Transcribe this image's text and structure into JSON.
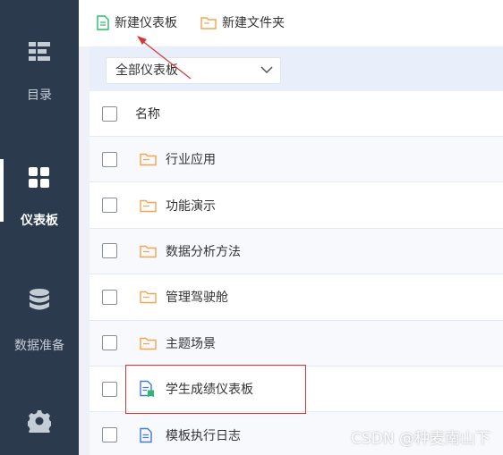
{
  "sidebar": {
    "items": [
      {
        "label": "目录",
        "icon": "catalog-icon",
        "active": false
      },
      {
        "label": "仪表板",
        "icon": "dashboard-icon",
        "active": true
      },
      {
        "label": "数据准备",
        "icon": "database-icon",
        "active": false
      },
      {
        "label": "",
        "icon": "settings-gear-icon",
        "active": false
      }
    ]
  },
  "toolbar": {
    "new_dashboard": "新建仪表板",
    "new_folder": "新建文件夹"
  },
  "filter": {
    "selected": "全部仪表板"
  },
  "list": {
    "header": "名称",
    "rows": [
      {
        "type": "folder",
        "label": "行业应用"
      },
      {
        "type": "folder",
        "label": "功能演示"
      },
      {
        "type": "folder",
        "label": "数据分析方法"
      },
      {
        "type": "folder",
        "label": "管理驾驶舱"
      },
      {
        "type": "folder",
        "label": "主题场景"
      },
      {
        "type": "dashboard",
        "label": "学生成绩仪表板"
      },
      {
        "type": "dashboard",
        "label": "模板执行日志"
      }
    ]
  },
  "colors": {
    "sidebar_bg": "#2b3a4d",
    "folder": "#f3a64d",
    "doc_blue": "#3f7be0",
    "doc_green": "#2dbb6a",
    "annotation_red": "#d6383a"
  },
  "watermark": "CSDN @种麦南山下"
}
